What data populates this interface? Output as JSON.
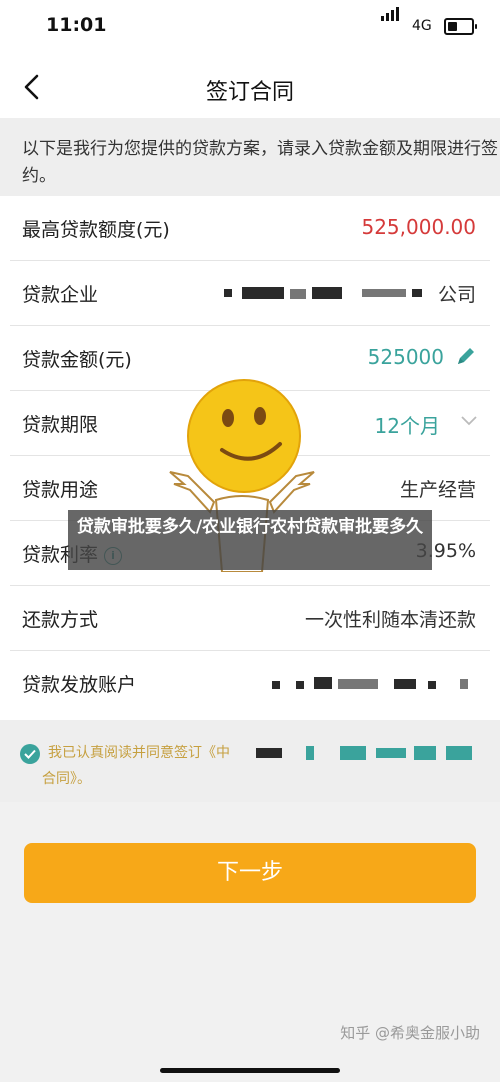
{
  "status_bar": {
    "time": "11:01",
    "network": "4G"
  },
  "nav": {
    "title": "签订合同"
  },
  "notice": {
    "text": "以下是我行为您提供的贷款方案，请录入贷款金额及期限进行签约。"
  },
  "rows": [
    {
      "label": "最高贷款额度(元)",
      "value": "525,000.00"
    },
    {
      "label": "贷款企业",
      "value": "公司"
    },
    {
      "label": "贷款金额(元)",
      "value": "525000"
    },
    {
      "label": "贷款期限",
      "value": "12个月"
    },
    {
      "label": "贷款用途",
      "value": "生产经营"
    },
    {
      "label": "贷款利率",
      "value": "3.95%"
    },
    {
      "label": "还款方式",
      "value": "一次性利随本清还款"
    },
    {
      "label": "贷款发放账户",
      "value": ""
    }
  ],
  "agreement": {
    "line1": "我已认真阅读并同意签订《中",
    "line2": "合同》。"
  },
  "next_button": {
    "label": "下一步"
  },
  "watermark": {
    "text": "知乎 @希奥金服小助"
  },
  "overlay": {
    "title": "贷款审批要多久/农业银行农村贷款审批要多久"
  },
  "colors": {
    "accent_teal": "#3aa39c",
    "red": "#d53a3a",
    "button_orange": "#f7a818",
    "agreement_gold": "#c6a040"
  },
  "icons": {
    "back": "chevron-left-icon",
    "edit": "pencil-icon",
    "dropdown": "chevron-down-icon",
    "info": "info-icon",
    "check": "check-circle-icon"
  }
}
